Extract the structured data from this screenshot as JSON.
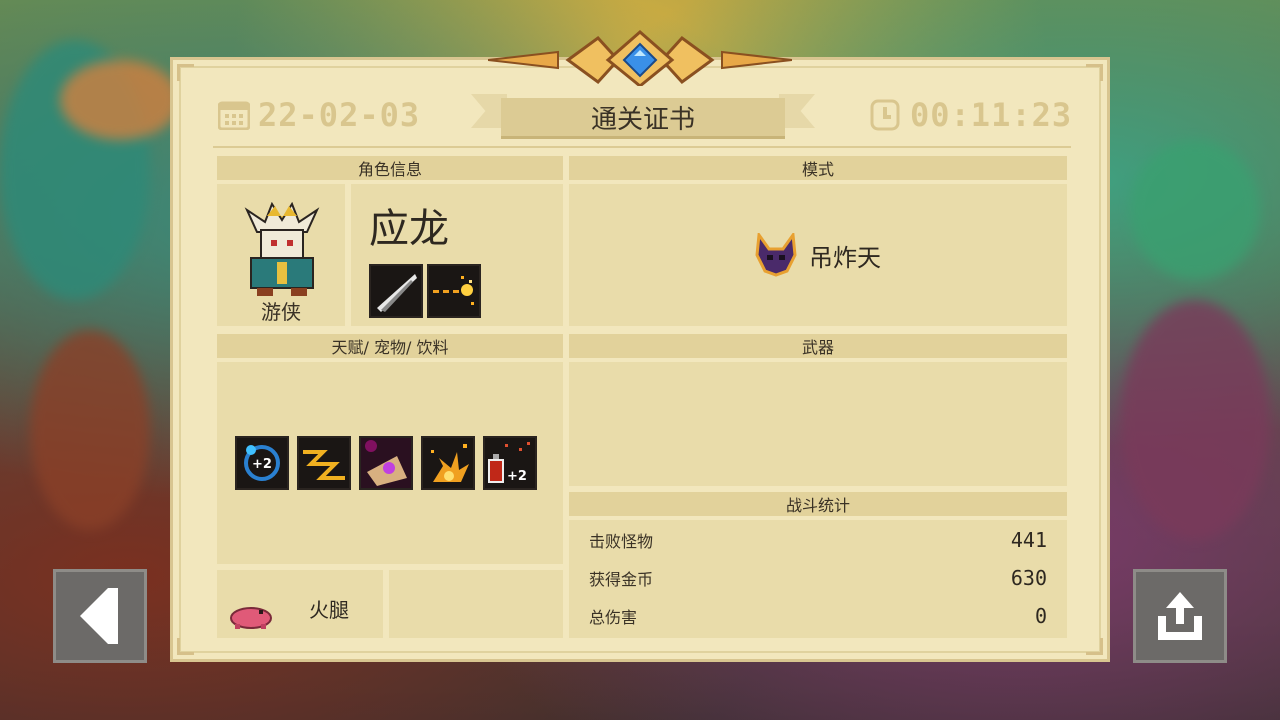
{
  "certificate": {
    "title": "通关证书",
    "date": "22-02-03",
    "time": "00:11:23"
  },
  "character_panel": {
    "header": "角色信息",
    "name": "应龙",
    "class": "游侠",
    "skills": [
      "blade-slash-skill-icon",
      "spark-dash-skill-icon"
    ]
  },
  "mode_panel": {
    "header": "模式",
    "mode_name": "吊炸天",
    "mode_icon": "demon-horn-icon"
  },
  "talents_panel": {
    "header": "天赋/ 宠物/ 饮料",
    "items": [
      "blue-orb-plus2-icon",
      "lightning-strike-icon",
      "magic-scroll-icon",
      "fire-burst-icon",
      "red-potion-plus2-icon"
    ],
    "pet_name": "火腿",
    "pet_icon": "pink-pig-icon"
  },
  "weapons_panel": {
    "header": "武器"
  },
  "stats_panel": {
    "header": "战斗统计",
    "rows": [
      {
        "label": "击败怪物",
        "value": "441"
      },
      {
        "label": "获得金币",
        "value": "630"
      },
      {
        "label": "总伤害",
        "value": "0"
      }
    ]
  },
  "colors": {
    "paper": "#f2e7bd",
    "panel": "#e9dcaa",
    "header_strip": "#e2d29b",
    "faded_text": "#d9c68e",
    "button": "#6c6a68"
  }
}
